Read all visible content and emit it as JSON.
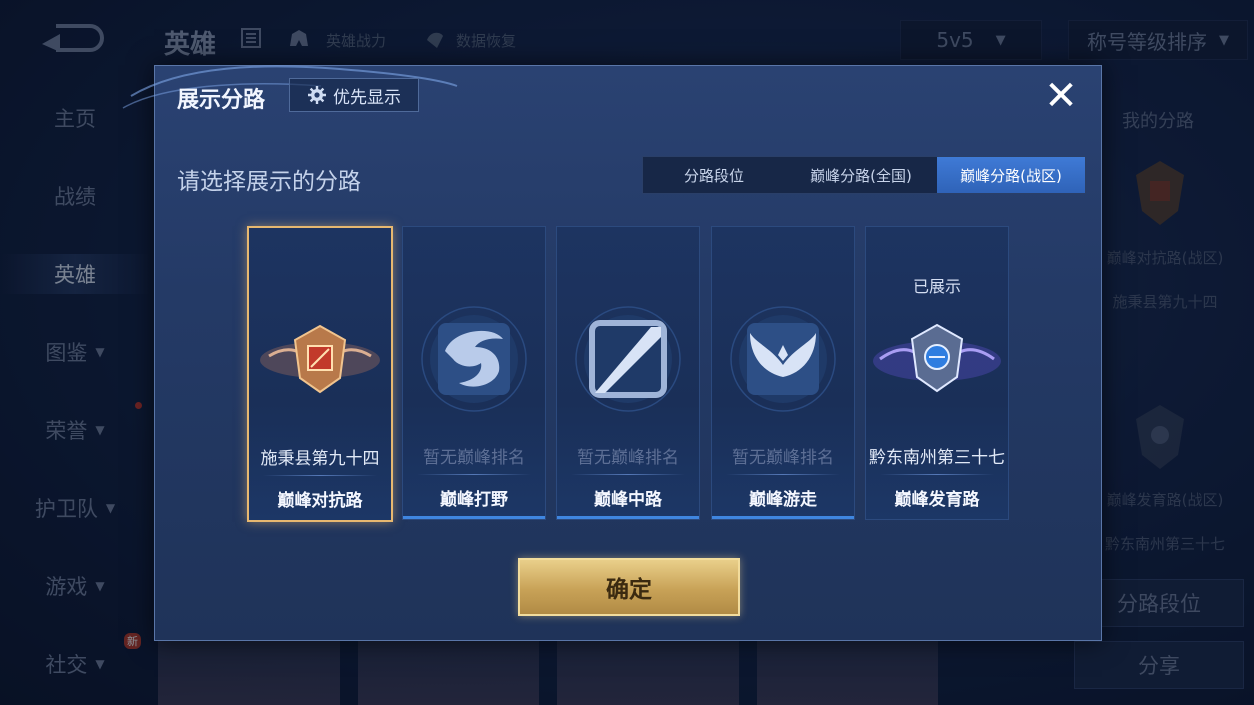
{
  "colors": {
    "accent_blue": "#2f63b8",
    "gold": "#e7b870",
    "modal_bg": "#243a66"
  },
  "background": {
    "top_title": "英雄",
    "top_links": [
      "英雄战力",
      "数据恢复"
    ],
    "mode_select": "5v5",
    "sort_select": "称号等级排序",
    "sidebar": [
      {
        "label": "主页"
      },
      {
        "label": "战绩"
      },
      {
        "label": "英雄"
      },
      {
        "label": "图鉴"
      },
      {
        "label": "荣誉"
      },
      {
        "label": "护卫队"
      },
      {
        "label": "游戏"
      },
      {
        "label": "社交"
      }
    ],
    "new_badge": "新",
    "right_panel": {
      "title": "我的分路",
      "lane1_name": "巅峰对抗路(战区)",
      "lane1_rank": "施秉县第九十四",
      "lane2_name": "巅峰发育路(战区)",
      "lane2_rank": "黔东南州第三十七",
      "btn_lane_rank": "分路段位",
      "btn_share": "分享"
    }
  },
  "modal": {
    "title": "展示分路",
    "priority_button": "优先显示",
    "subtitle": "请选择展示的分路",
    "tabs": [
      {
        "label": "分路段位",
        "active": false
      },
      {
        "label": "巅峰分路(全国)",
        "active": false
      },
      {
        "label": "巅峰分路(战区)",
        "active": true
      }
    ],
    "cards": [
      {
        "name": "巅峰对抗路",
        "rank": "施秉县第九十四",
        "shown": "",
        "selected": true,
        "emblem": "gold-shield-icon"
      },
      {
        "name": "巅峰打野",
        "rank": "暂无巅峰排名",
        "shown": "",
        "selected": false,
        "emblem": "dragon-icon"
      },
      {
        "name": "巅峰中路",
        "rank": "暂无巅峰排名",
        "shown": "",
        "selected": false,
        "emblem": "slash-icon"
      },
      {
        "name": "巅峰游走",
        "rank": "暂无巅峰排名",
        "shown": "",
        "selected": false,
        "emblem": "wings-icon"
      },
      {
        "name": "巅峰发育路",
        "rank": "黔东南州第三十七",
        "shown": "已展示",
        "selected": false,
        "emblem": "silver-shield-icon"
      }
    ],
    "confirm_button": "确定"
  }
}
